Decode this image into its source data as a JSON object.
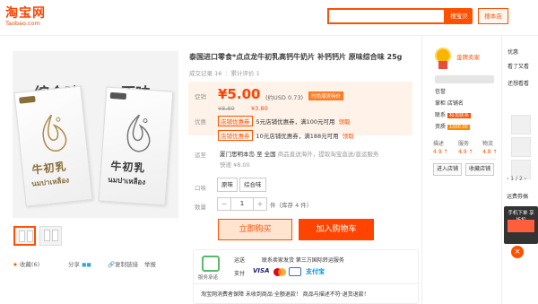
{
  "header": {
    "logo_text": "淘宝网",
    "logo_sub": "Taobao.com",
    "search_button": "搜宝贝",
    "search_store_button": "搜本店"
  },
  "gallery": {
    "flavor_combo": "综合味",
    "flavor_original": "原味",
    "pack_cn": "牛初乳",
    "pack_th": "นมปาเหลือง"
  },
  "actions": {
    "favorite": "收藏(6)",
    "share": "分享",
    "copy_link": "复制链接",
    "report": "举报"
  },
  "product": {
    "title": "泰国进口零食*点点龙牛初乳高钙牛奶片 补钙钙片 原味综合味 25g",
    "sales_label": "成交记录 16",
    "reviews_label": "累计评价 1"
  },
  "price": {
    "label": "促销",
    "value": "¥5.00",
    "usd": "(约USD 0.73)",
    "ribbon": "时尚潮流特价",
    "old_price": "¥8.80",
    "mini_price": "¥3.80",
    "coupon_label": "优惠",
    "coupon1_tag": "店铺优惠券",
    "coupon1_text": "5元店铺优惠券，满100元可用",
    "coupon1_get": "领取",
    "coupon2_tag": "店铺优惠券",
    "coupon2_text": "10元店铺优惠券，满188元可用",
    "coupon2_get": "领取"
  },
  "shipping": {
    "label": "运至",
    "line1": "厦门思明本岛 至 全国",
    "line1_extra": "商品直送海外，提取淘宝直送/直运服务",
    "line2": "快递 ¥8.00"
  },
  "taste": {
    "label": "口味",
    "options": [
      "原味",
      "综合味"
    ]
  },
  "quantity": {
    "label": "数量",
    "minus": "−",
    "value": "1",
    "plus": "+",
    "unit": "件（库存 4 件）"
  },
  "buttons": {
    "buy_now": "立即购买",
    "add_to_cart": "加入购物车"
  },
  "assurance": {
    "caption": "服务承诺",
    "item_a": "运送",
    "item_b": "联系卖家发货 第三方国际转运服务",
    "pay_label": "支付",
    "visa": "VISA",
    "alipay": "支付宝",
    "consumer": "淘宝网消费者保障   未收到商品·全额退款！   商品与描述不符·退货退款！"
  },
  "seller": {
    "gold_seller": "金牌卖家",
    "line1": "信誉",
    "line2": "掌柜  店铺名",
    "contact_label": "联系",
    "contact_badge": "和我联系",
    "qualification": "资质",
    "qualification_mark": "1000.00",
    "rating_heads": [
      "描述",
      "服务",
      "物流"
    ],
    "rating_vals": [
      "4.9 ↑",
      "4.9 ↑",
      "4.8 ↑"
    ],
    "enter_shop": "进入店铺",
    "fav_shop": "收藏店铺"
  },
  "right_col": {
    "item1": "优惠",
    "item2": "看了又看",
    "item3": "还想看看",
    "pager": "‹ 1 / 2 ›",
    "more": "运费券搞"
  },
  "float_promo": {
    "text": "手机下单 享折扣",
    "close": "×"
  }
}
